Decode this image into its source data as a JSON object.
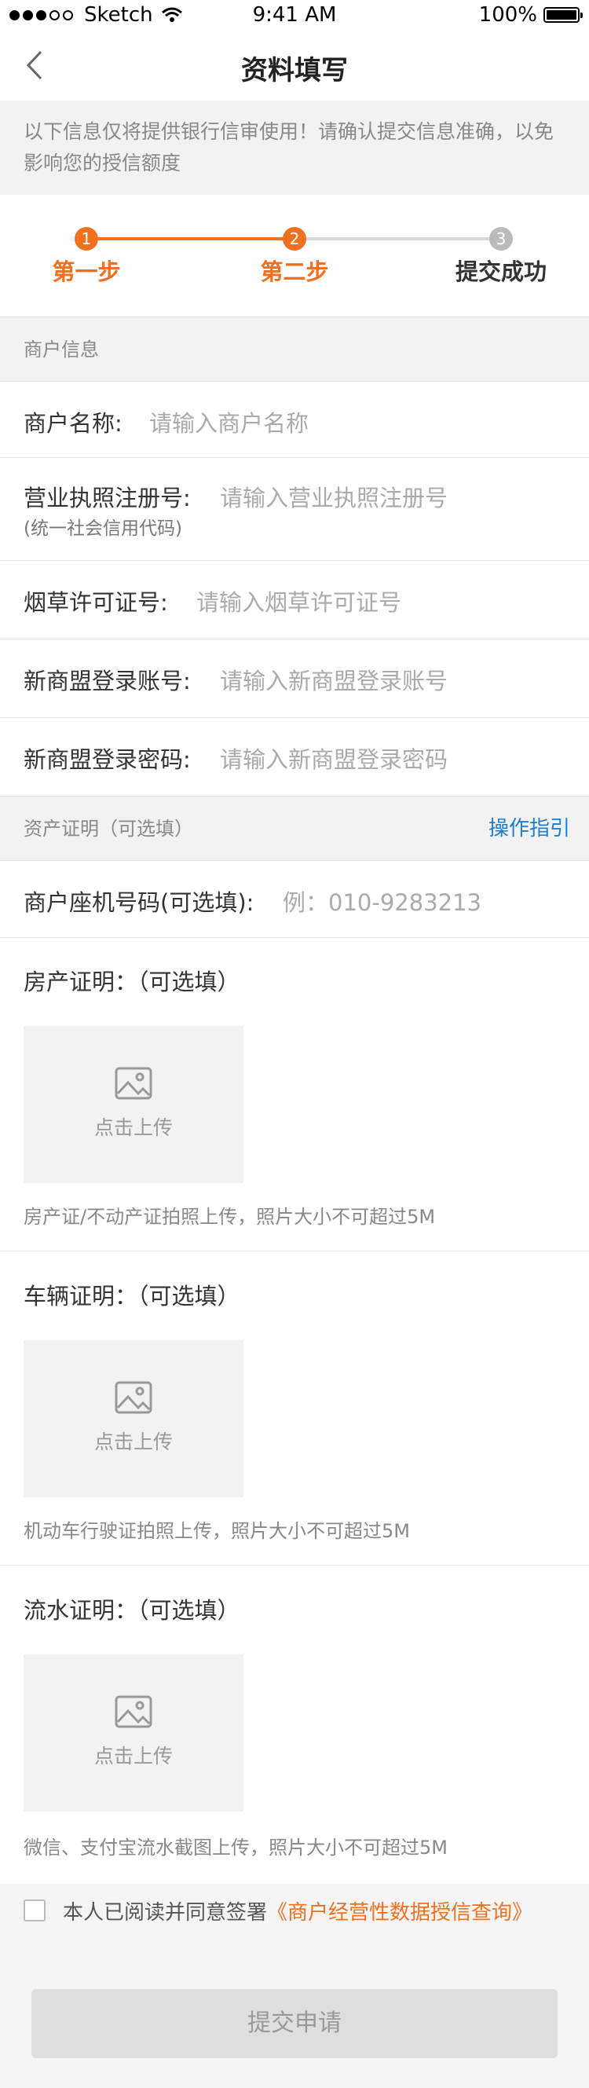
{
  "status_bar": {
    "carrier": "Sketch",
    "time": "9:41 AM",
    "battery": "100%"
  },
  "nav": {
    "title": "资料填写"
  },
  "notice": {
    "text": "以下信息仅将提供银行信审使用！请确认提交信息准确，以免影响您的授信额度"
  },
  "steps": [
    {
      "num": "1",
      "label": "第一步",
      "state": "done"
    },
    {
      "num": "2",
      "label": "第二步",
      "state": "active"
    },
    {
      "num": "3",
      "label": "提交成功",
      "state": "pending"
    }
  ],
  "colors": {
    "accent": "#f07020",
    "pending": "#bbbbbb",
    "link": "#1a7fd5"
  },
  "merchant_section": {
    "title": "商户信息"
  },
  "merchant_fields": [
    {
      "label": "商户名称:",
      "placeholder": "请输入商户名称"
    },
    {
      "label": "营业执照注册号:",
      "placeholder": "请输入营业执照注册号",
      "sub": "(统一社会信用代码)"
    },
    {
      "label": "烟草许可证号:",
      "placeholder": "请输入烟草许可证号"
    },
    {
      "label": "新商盟登录账号:",
      "placeholder": "请输入新商盟登录账号"
    },
    {
      "label": "新商盟登录密码:",
      "placeholder": "请输入新商盟登录密码"
    }
  ],
  "asset_section": {
    "title": "资产证明（可选填）",
    "link": "操作指引"
  },
  "phone_field": {
    "label": "商户座机号码(可选填):",
    "placeholder": "例：010-9283213"
  },
  "proofs": [
    {
      "title": "房产证明：（可选填）",
      "upload": "点击上传",
      "hint": "房产证/不动产证拍照上传，照片大小不可超过5M"
    },
    {
      "title": "车辆证明：（可选填）",
      "upload": "点击上传",
      "hint": "机动车行驶证拍照上传，照片大小不可超过5M"
    },
    {
      "title": "流水证明：（可选填）",
      "upload": "点击上传",
      "hint": "微信、支付宝流水截图上传，照片大小不可超过5M"
    }
  ],
  "agreement": {
    "text": "本人已阅读并同意签署",
    "link": "《商户经营性数据授信查询》"
  },
  "submit": {
    "label": "提交申请"
  }
}
